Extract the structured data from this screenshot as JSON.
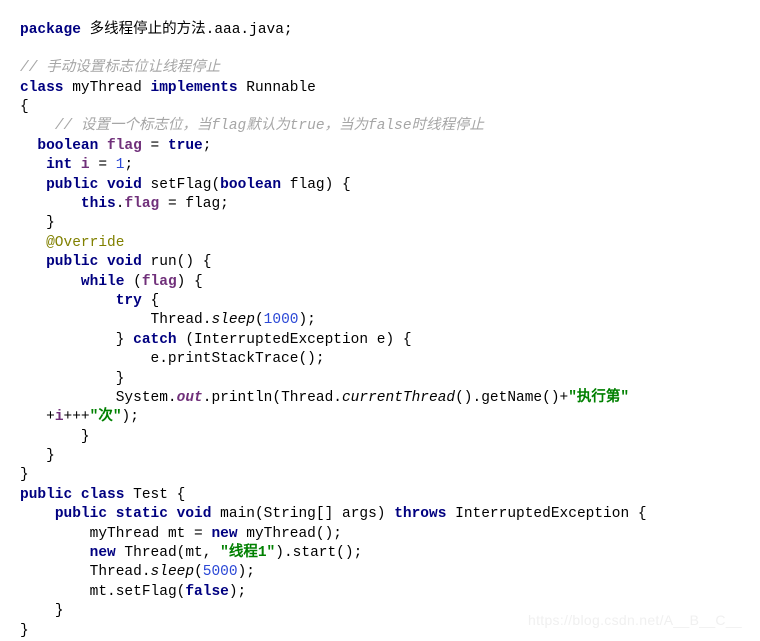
{
  "editor": {
    "language": "java",
    "background_color": "#ffffff",
    "colors": {
      "keyword": "#000080",
      "plain": "#000000",
      "comment": "#a6a6a6",
      "annotation": "#808000",
      "field": "#70307a",
      "number": "#2b48d6",
      "string": "#008000"
    }
  },
  "watermark": {
    "text": "https://blog.csdn.net/A__B__C__"
  },
  "code": {
    "lines": [
      {
        "id": "line-1",
        "indent": "",
        "segments": [
          {
            "t": "package",
            "c": "kw"
          },
          {
            "t": " 多线程停止的方法.aaa.java;",
            "c": "pln"
          }
        ]
      },
      {
        "id": "line-2",
        "indent": "",
        "segments": []
      },
      {
        "id": "line-3",
        "indent": "",
        "segments": [
          {
            "t": "// 手动设置标志位让线程停止",
            "c": "cmt"
          }
        ]
      },
      {
        "id": "line-4",
        "indent": "",
        "segments": [
          {
            "t": "class",
            "c": "kw"
          },
          {
            "t": " myThread ",
            "c": "pln"
          },
          {
            "t": "implements",
            "c": "kw"
          },
          {
            "t": " Runnable",
            "c": "pln"
          }
        ]
      },
      {
        "id": "line-5",
        "indent": "",
        "segments": [
          {
            "t": "{",
            "c": "pln"
          }
        ]
      },
      {
        "id": "line-6",
        "indent": "    ",
        "segments": [
          {
            "t": "// 设置一个标志位，当flag默认为true，当为false时线程停止",
            "c": "cmt"
          }
        ]
      },
      {
        "id": "line-7",
        "indent": "  ",
        "segments": [
          {
            "t": "boolean",
            "c": "kw"
          },
          {
            "t": " ",
            "c": "pln"
          },
          {
            "t": "flag",
            "c": "fld"
          },
          {
            "t": " = ",
            "c": "pln"
          },
          {
            "t": "true",
            "c": "kw"
          },
          {
            "t": ";",
            "c": "pln"
          }
        ]
      },
      {
        "id": "line-8",
        "indent": "   ",
        "segments": [
          {
            "t": "int",
            "c": "kw"
          },
          {
            "t": " ",
            "c": "pln"
          },
          {
            "t": "i",
            "c": "fld"
          },
          {
            "t": " = ",
            "c": "pln"
          },
          {
            "t": "1",
            "c": "num"
          },
          {
            "t": ";",
            "c": "pln"
          }
        ]
      },
      {
        "id": "line-9",
        "indent": "   ",
        "segments": [
          {
            "t": "public",
            "c": "kw"
          },
          {
            "t": " ",
            "c": "pln"
          },
          {
            "t": "void",
            "c": "kw"
          },
          {
            "t": " setFlag(",
            "c": "pln"
          },
          {
            "t": "boolean",
            "c": "kw"
          },
          {
            "t": " flag) {",
            "c": "pln"
          }
        ]
      },
      {
        "id": "line-10",
        "indent": "       ",
        "segments": [
          {
            "t": "this",
            "c": "kw"
          },
          {
            "t": ".",
            "c": "pln"
          },
          {
            "t": "flag",
            "c": "fld"
          },
          {
            "t": " = flag;",
            "c": "pln"
          }
        ]
      },
      {
        "id": "line-11",
        "indent": "   ",
        "segments": [
          {
            "t": "}",
            "c": "pln"
          }
        ]
      },
      {
        "id": "line-12",
        "indent": "   ",
        "segments": [
          {
            "t": "@Override",
            "c": "ann"
          }
        ]
      },
      {
        "id": "line-13",
        "indent": "   ",
        "segments": [
          {
            "t": "public",
            "c": "kw"
          },
          {
            "t": " ",
            "c": "pln"
          },
          {
            "t": "void",
            "c": "kw"
          },
          {
            "t": " run() {",
            "c": "pln"
          }
        ]
      },
      {
        "id": "line-14",
        "indent": "       ",
        "segments": [
          {
            "t": "while",
            "c": "kw"
          },
          {
            "t": " (",
            "c": "pln"
          },
          {
            "t": "flag",
            "c": "fld"
          },
          {
            "t": ") {",
            "c": "pln"
          }
        ]
      },
      {
        "id": "line-15",
        "indent": "           ",
        "segments": [
          {
            "t": "try",
            "c": "kw"
          },
          {
            "t": " {",
            "c": "pln"
          }
        ]
      },
      {
        "id": "line-16",
        "indent": "               ",
        "segments": [
          {
            "t": "Thread.",
            "c": "pln"
          },
          {
            "t": "sleep",
            "c": "mtd"
          },
          {
            "t": "(",
            "c": "pln"
          },
          {
            "t": "1000",
            "c": "num"
          },
          {
            "t": ");",
            "c": "pln"
          }
        ]
      },
      {
        "id": "line-17",
        "indent": "           ",
        "segments": [
          {
            "t": "} ",
            "c": "pln"
          },
          {
            "t": "catch",
            "c": "kw"
          },
          {
            "t": " (InterruptedException e) {",
            "c": "pln"
          }
        ]
      },
      {
        "id": "line-18",
        "indent": "               ",
        "segments": [
          {
            "t": "e.printStackTrace();",
            "c": "pln"
          }
        ]
      },
      {
        "id": "line-19",
        "indent": "           ",
        "segments": [
          {
            "t": "}",
            "c": "pln"
          }
        ]
      },
      {
        "id": "line-20",
        "indent": "           ",
        "segments": [
          {
            "t": "System.",
            "c": "pln"
          },
          {
            "t": "out",
            "c": "fldi"
          },
          {
            "t": ".println(Thread.",
            "c": "pln"
          },
          {
            "t": "currentThread",
            "c": "mtd"
          },
          {
            "t": "().getName()+",
            "c": "pln"
          },
          {
            "t": "\"执行第\"",
            "c": "str"
          }
        ]
      },
      {
        "id": "line-21",
        "indent": "   ",
        "segments": [
          {
            "t": "+",
            "c": "pln"
          },
          {
            "t": "i",
            "c": "fld"
          },
          {
            "t": "+++",
            "c": "pln"
          },
          {
            "t": "\"次\"",
            "c": "str"
          },
          {
            "t": ");",
            "c": "pln"
          }
        ]
      },
      {
        "id": "line-22",
        "indent": "       ",
        "segments": [
          {
            "t": "}",
            "c": "pln"
          }
        ]
      },
      {
        "id": "line-23",
        "indent": "   ",
        "segments": [
          {
            "t": "}",
            "c": "pln"
          }
        ]
      },
      {
        "id": "line-24",
        "indent": "",
        "segments": [
          {
            "t": "}",
            "c": "pln"
          }
        ]
      },
      {
        "id": "line-25",
        "indent": "",
        "segments": [
          {
            "t": "public",
            "c": "kw"
          },
          {
            "t": " ",
            "c": "pln"
          },
          {
            "t": "class",
            "c": "kw"
          },
          {
            "t": " Test {",
            "c": "pln"
          }
        ]
      },
      {
        "id": "line-26",
        "indent": "    ",
        "segments": [
          {
            "t": "public",
            "c": "kw"
          },
          {
            "t": " ",
            "c": "pln"
          },
          {
            "t": "static",
            "c": "kw"
          },
          {
            "t": " ",
            "c": "pln"
          },
          {
            "t": "void",
            "c": "kw"
          },
          {
            "t": " main(String[] args) ",
            "c": "pln"
          },
          {
            "t": "throws",
            "c": "kw"
          },
          {
            "t": " InterruptedException {",
            "c": "pln"
          }
        ]
      },
      {
        "id": "line-27",
        "indent": "        ",
        "segments": [
          {
            "t": "myThread mt = ",
            "c": "pln"
          },
          {
            "t": "new",
            "c": "kw"
          },
          {
            "t": " myThread();",
            "c": "pln"
          }
        ]
      },
      {
        "id": "line-28",
        "indent": "        ",
        "segments": [
          {
            "t": "new",
            "c": "kw"
          },
          {
            "t": " Thread(mt, ",
            "c": "pln"
          },
          {
            "t": "\"线程1\"",
            "c": "str"
          },
          {
            "t": ").start();",
            "c": "pln"
          }
        ]
      },
      {
        "id": "line-29",
        "indent": "        ",
        "segments": [
          {
            "t": "Thread.",
            "c": "pln"
          },
          {
            "t": "sleep",
            "c": "mtd"
          },
          {
            "t": "(",
            "c": "pln"
          },
          {
            "t": "5000",
            "c": "num"
          },
          {
            "t": ");",
            "c": "pln"
          }
        ]
      },
      {
        "id": "line-30",
        "indent": "        ",
        "segments": [
          {
            "t": "mt.setFlag(",
            "c": "pln"
          },
          {
            "t": "false",
            "c": "kw"
          },
          {
            "t": ");",
            "c": "pln"
          }
        ]
      },
      {
        "id": "line-31",
        "indent": "    ",
        "segments": [
          {
            "t": "}",
            "c": "pln"
          }
        ]
      },
      {
        "id": "line-32",
        "indent": "",
        "segments": [
          {
            "t": "}",
            "c": "pln"
          }
        ]
      }
    ]
  }
}
